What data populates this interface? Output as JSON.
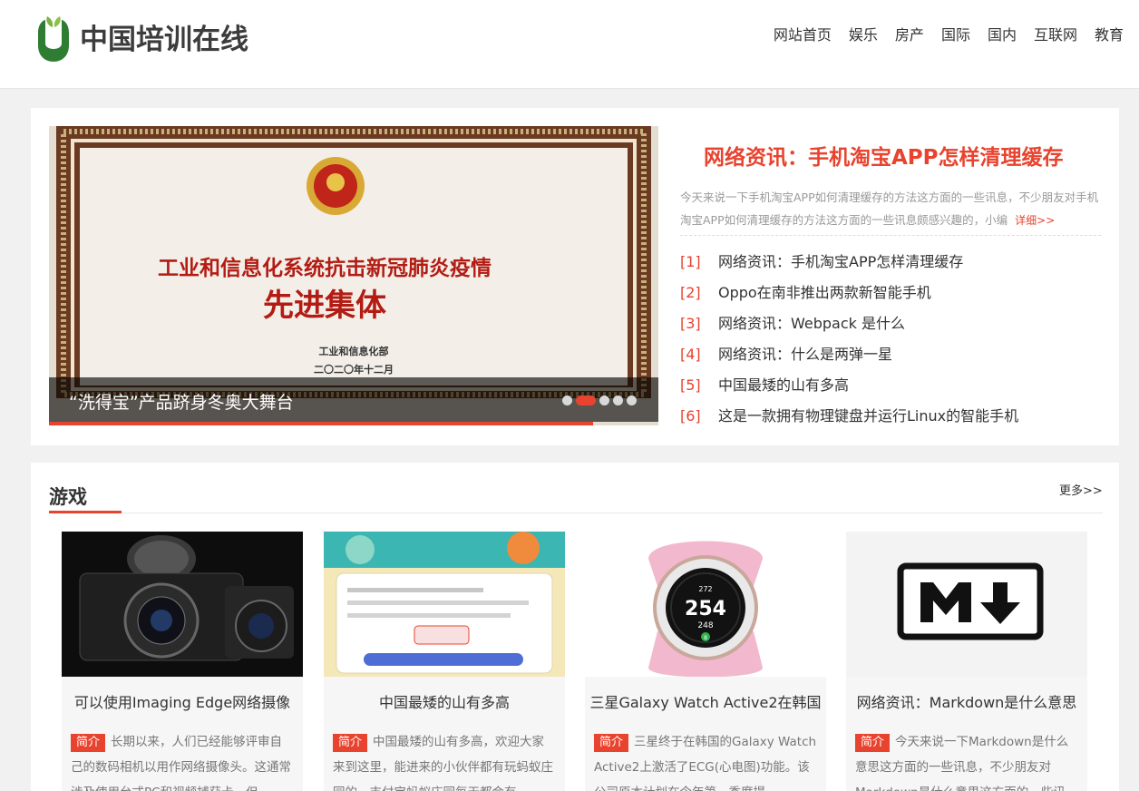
{
  "header": {
    "logo_text": "中国培训在线",
    "nav": [
      "网站首页",
      "娱乐",
      "房产",
      "国际",
      "国内",
      "互联网",
      "教育"
    ]
  },
  "slider": {
    "image_text_line1": "工业和信息化系统抗击新冠肺炎疫情",
    "image_text_line2": "先进集体",
    "image_issuer": "工业和信息化部",
    "image_date": "二〇二〇年十二月",
    "caption": "“洗得宝”产品跻身冬奥大舞台",
    "dots_count": 5,
    "active_dot": 2
  },
  "headline": {
    "title": "网络资讯：手机淘宝APP怎样清理缓存",
    "summary": "今天来说一下手机淘宝APP如何清理缓存的方法这方面的一些讯息，不少朋友对手机淘宝APP如何清理缓存的方法这方面的一些讯息颇感兴趣的，小编",
    "more": "详细>>",
    "list": [
      {
        "num": "[1]",
        "text": "网络资讯：手机淘宝APP怎样清理缓存"
      },
      {
        "num": "[2]",
        "text": "Oppo在南非推出两款新智能手机"
      },
      {
        "num": "[3]",
        "text": "网络资讯：Webpack 是什么"
      },
      {
        "num": "[4]",
        "text": "网络资讯：什么是两弹一星"
      },
      {
        "num": "[5]",
        "text": "中国最矮的山有多高"
      },
      {
        "num": "[6]",
        "text": "这是一款拥有物理键盘并运行Linux的智能手机"
      }
    ]
  },
  "games": {
    "title": "游戏",
    "more": "更多>>",
    "badge": "简介",
    "cards": [
      {
        "title": "可以使用Imaging Edge网络摄像",
        "desc": "长期以来，人们已经能够评审自己的数码相机以用作网络摄像头。这通常涉及使用台式PC和视频捕获卡，但"
      },
      {
        "title": "中国最矮的山有多高",
        "desc": "中国最矮的山有多高，欢迎大家来到这里，能进来的小伙伴都有玩蚂蚁庄园的，支付宝蚂蚁庄园每天都会有"
      },
      {
        "title": "三星Galaxy Watch Active2在韩国",
        "desc": "三星终于在韩国的Galaxy Watch Active2上激活了ECG(心电图)功能。该公司原本计划在今年第一季度提"
      },
      {
        "title": "网络资讯：Markdown是什么意思",
        "desc": "今天来说一下Markdown是什么意思这方面的一些讯息，不少朋友对Markdown是什么意思这方面的一些讯"
      }
    ],
    "watch_readout": {
      "top": "272",
      "main": "254",
      "bottom": "248",
      "badge": "8"
    }
  },
  "colors": {
    "accent": "#e8432e",
    "logo_green": "#2e7d32"
  }
}
